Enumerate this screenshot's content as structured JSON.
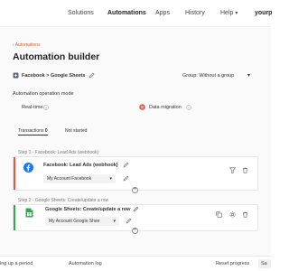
{
  "nav": {
    "items": [
      {
        "label": "Solutions",
        "active": false
      },
      {
        "label": "Automations",
        "active": true
      },
      {
        "label": "Apps",
        "active": false
      },
      {
        "label": "History",
        "active": false
      },
      {
        "label": "Help",
        "active": false
      }
    ],
    "user_label": "yourp",
    "caret": "▾"
  },
  "page": {
    "back_label": "‹ Automations",
    "title": "Automation builder",
    "automation_name": "Facebook > Google Sheets",
    "group_select": "Group: Without a group",
    "mode_heading": "Automation operation mode",
    "mode_realtime": "Real-time",
    "mode_migration": "Data migration",
    "transactions_label": "Transactions",
    "transactions_count": "0",
    "status_label": "Not started"
  },
  "steps": [
    {
      "caption": "Step 1 - Facebook: Lead Ads (webhook)",
      "name": "Facebook: Lead Ads (webhook)",
      "account": "My Account Facebook",
      "stripe_color": "#e8583a",
      "icon": "facebook-icon"
    },
    {
      "caption": "Step 2 - Google Sheets: Create/update a row",
      "name": "Google Sheets: Create/update a row",
      "account": "My Account Google Shee",
      "stripe_color": "#34a853",
      "icon": "google-sheets-icon"
    }
  ],
  "footer": {
    "item1": "ing up a period",
    "item2": "Automation log",
    "item3": "Reset progress",
    "item4": "Sa"
  },
  "colors": {
    "accent": "#e05a2b",
    "facebook": "#1877f2",
    "sheets": "#34a853",
    "migration_badge": "#e8583a"
  }
}
